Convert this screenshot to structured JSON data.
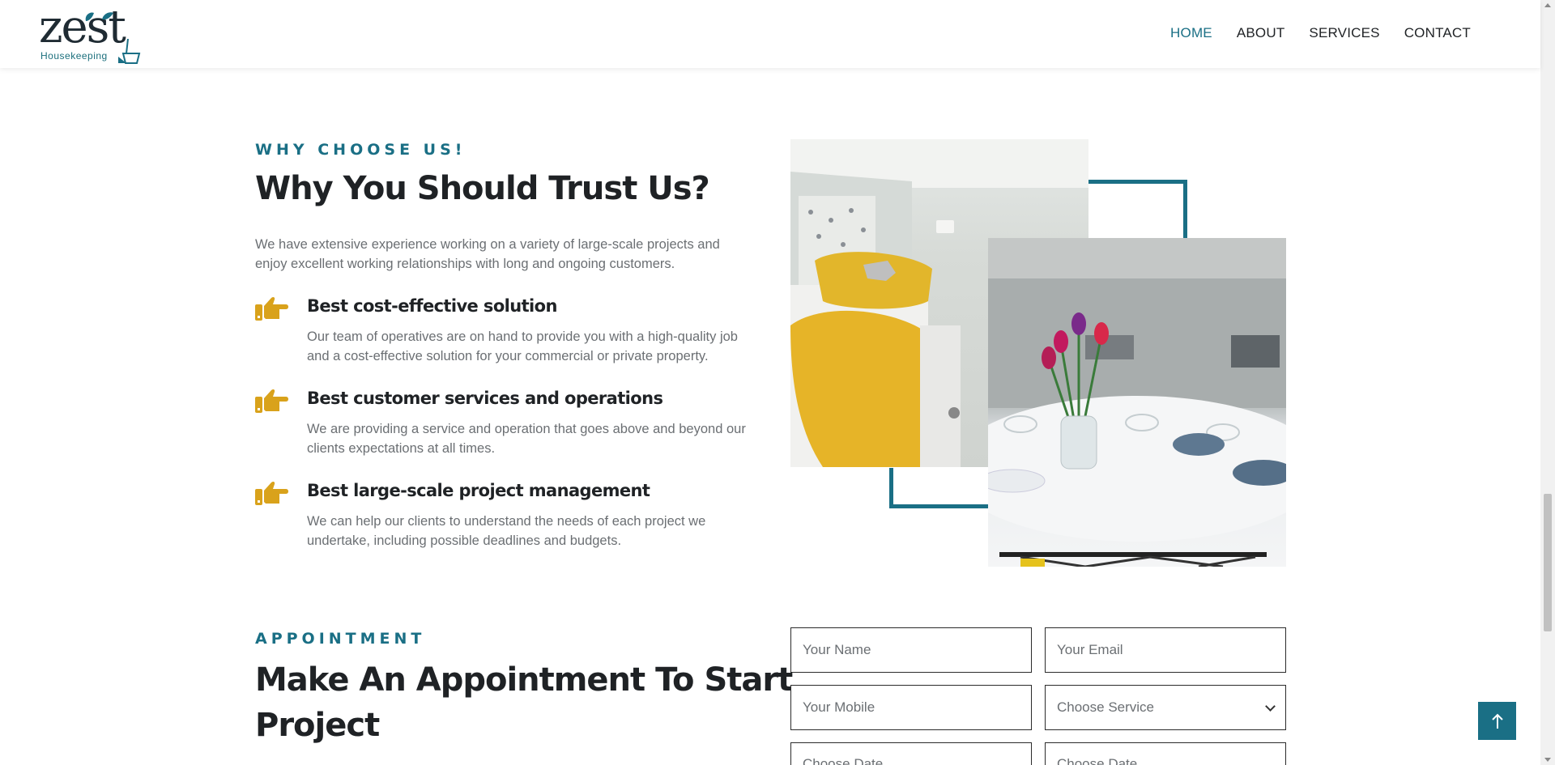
{
  "brand": {
    "logo_word": "zest",
    "logo_sub": "Housekeeping"
  },
  "nav": {
    "items": [
      "HOME",
      "ABOUT",
      "SERVICES",
      "CONTACT"
    ],
    "active": "HOME"
  },
  "why": {
    "eyebrow": "WHY CHOOSE US!",
    "title": "Why You Should Trust Us?",
    "lead": "We have extensive experience working on a variety of large-scale projects and enjoy excellent working relationships with long and ongoing customers.",
    "features": [
      {
        "title": "Best cost-effective solution",
        "text": "Our team of operatives are on hand to provide you with a high-quality job and a cost-effective solution for your commercial or private property."
      },
      {
        "title": "Best customer services and operations",
        "text": "We are providing a service and operation that goes above and beyond our clients expectations at all times."
      },
      {
        "title": "Best large-scale project management",
        "text": "We can help our clients to understand the needs of each project we undertake, including possible deadlines and budgets."
      }
    ]
  },
  "appointment": {
    "eyebrow": "APPOINTMENT",
    "title_line1": "Make An Appointment To Start",
    "title_line2": "Project",
    "fields": {
      "name_placeholder": "Your Name",
      "email_placeholder": "Your Email",
      "mobile_placeholder": "Your Mobile",
      "service_selected": "Choose Service",
      "date1_placeholder": "Choose Date",
      "date2_placeholder": "Choose Date"
    }
  },
  "colors": {
    "accent": "#1a6f85",
    "icon": "#d9a21b",
    "heading": "#1f2225",
    "body_text": "#6b6f73"
  },
  "icons": {
    "feature": "pointing-hand-icon",
    "back_to_top": "arrow-up-icon"
  }
}
